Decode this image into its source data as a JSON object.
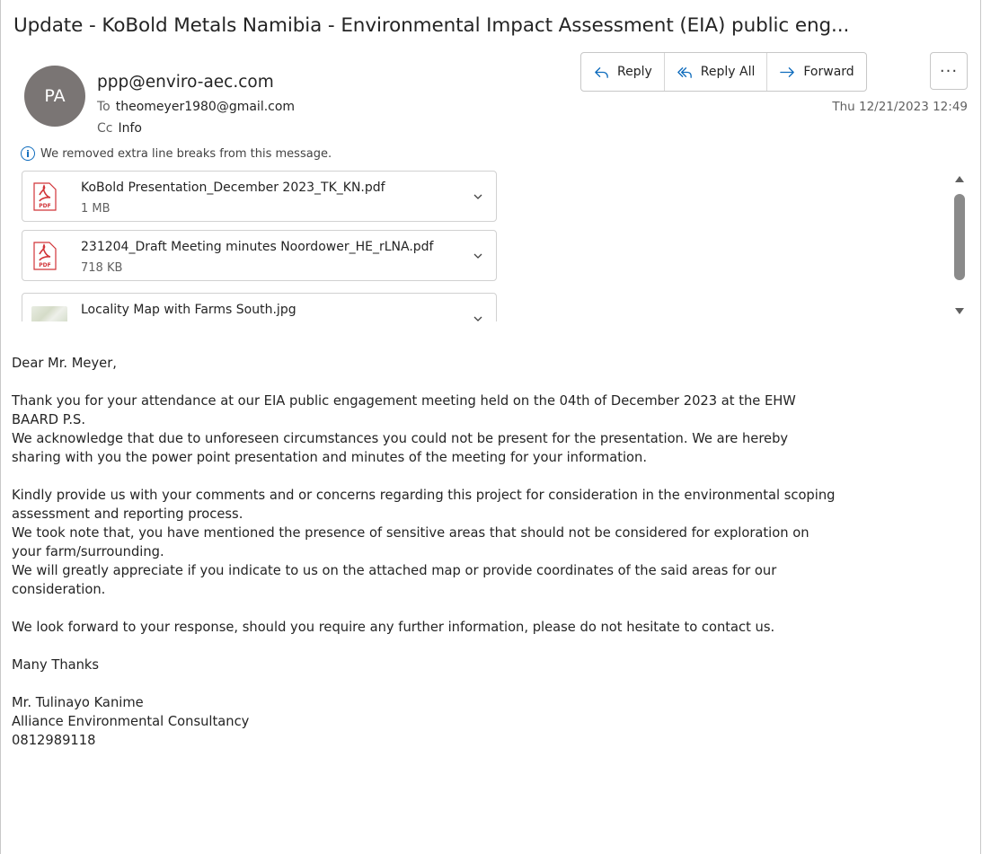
{
  "subject": "Update - KoBold Metals Namibia - Environmental Impact Assessment (EIA) public eng...",
  "sender": {
    "initials": "PA",
    "email": "ppp@enviro-aec.com",
    "to_label": "To",
    "to": "theomeyer1980@gmail.com",
    "cc_label": "Cc",
    "cc": "Info",
    "date": "Thu 12/21/2023 12:49"
  },
  "actions": {
    "reply": "Reply",
    "reply_all": "Reply All",
    "forward": "Forward",
    "more": "···"
  },
  "notice": "We removed extra line breaks from this message.",
  "attachments": [
    {
      "name": "KoBold Presentation_December 2023_TK_KN.pdf",
      "size": "1 MB",
      "type": "pdf"
    },
    {
      "name": "231204_Draft Meeting minutes Noordower_HE_rLNA.pdf",
      "size": "718 KB",
      "type": "pdf"
    },
    {
      "name": "Locality Map with Farms South.jpg",
      "size": "",
      "type": "image"
    }
  ],
  "pdf_icon_label": "PDF",
  "body": {
    "greeting": "Dear Mr. Meyer,",
    "p1_l1": "Thank you for your attendance at our EIA public engagement meeting held on the 04th of December 2023 at the EHW",
    "p1_l2": "BAARD P.S.",
    "p1_l3": "We acknowledge that due to unforeseen circumstances you could not be present for the presentation. We are hereby",
    "p1_l4": "sharing with you the power point presentation and minutes of the meeting for your information.",
    "p2_l1": "Kindly provide us with your comments and or concerns regarding this project for consideration in the environmental scoping",
    "p2_l2": "assessment and reporting process.",
    "p2_l3": "We took note that, you have mentioned the presence of sensitive areas that should not be considered for exploration on",
    "p2_l4": "your farm/surrounding.",
    "p2_l5": "We will greatly appreciate if you indicate to us on the attached map or provide coordinates of the said areas for our",
    "p2_l6": "consideration.",
    "p3": "We look forward to your response, should you require any further information, please do not hesitate to contact us.",
    "closing": "Many Thanks",
    "sig_name": "Mr. Tulinayo Kanime",
    "sig_company": "Alliance Environmental Consultancy",
    "sig_phone": "0812989118"
  },
  "colors": {
    "accent": "#0f6cbd",
    "avatar": "#7a7574",
    "pdf_red": "#d13438"
  }
}
